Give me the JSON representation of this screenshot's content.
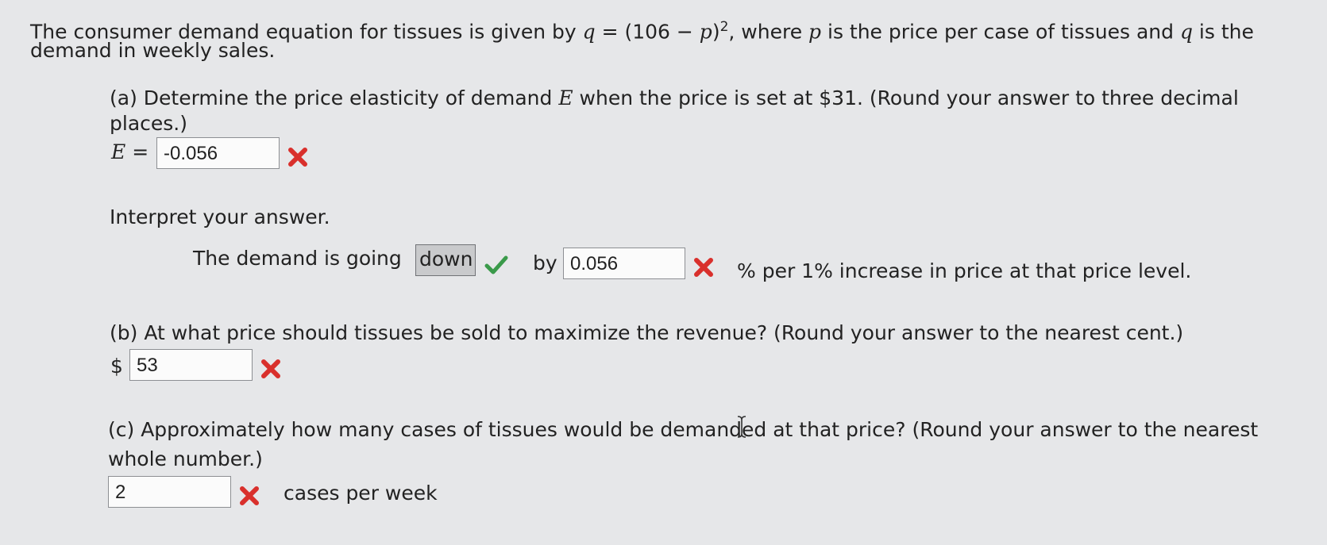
{
  "problem": {
    "intro_line1_a": "The consumer demand equation for tissues is given by ",
    "intro_var_q": "q",
    "intro_line1_b": " = (106 − ",
    "intro_var_p": "p",
    "intro_line1_c": ")",
    "intro_exp": "2",
    "intro_line1_d": ", where ",
    "intro_var_p2": "p",
    "intro_line1_e": " is the price per case of tissues and ",
    "intro_var_q2": "q",
    "intro_line1_f": " is the",
    "intro_line2": "demand in weekly sales."
  },
  "part_a": {
    "line1_a": "(a) Determine the price elasticity of demand ",
    "line1_var": "E",
    "line1_b": " when the price is set at $31. (Round your answer to three decimal",
    "line2": "places.)",
    "eq_var": "E",
    "eq_sign": " =",
    "answer": "-0.056",
    "answer_status": "incorrect"
  },
  "interpret": {
    "heading": "Interpret your answer.",
    "sentence_start": "The demand is going",
    "selection": "down",
    "selection_status": "correct",
    "by_label": "by",
    "answer": "0.056",
    "answer_status": "incorrect",
    "sentence_end": "% per 1% increase in price at that price level."
  },
  "part_b": {
    "question": "(b) At what price should tissues be sold to maximize the revenue? (Round your answer to the nearest cent.)",
    "currency": "$",
    "answer": "53",
    "answer_status": "incorrect"
  },
  "part_c": {
    "line1": "(c) Approximately how many cases of tissues would be demanded at that price? (Round your answer to the nearest",
    "line2": "whole number.)",
    "answer": "2",
    "answer_status": "incorrect",
    "unit": "cases per week"
  },
  "colors": {
    "incorrect": "#d9302c",
    "correct": "#3a9a4a"
  }
}
